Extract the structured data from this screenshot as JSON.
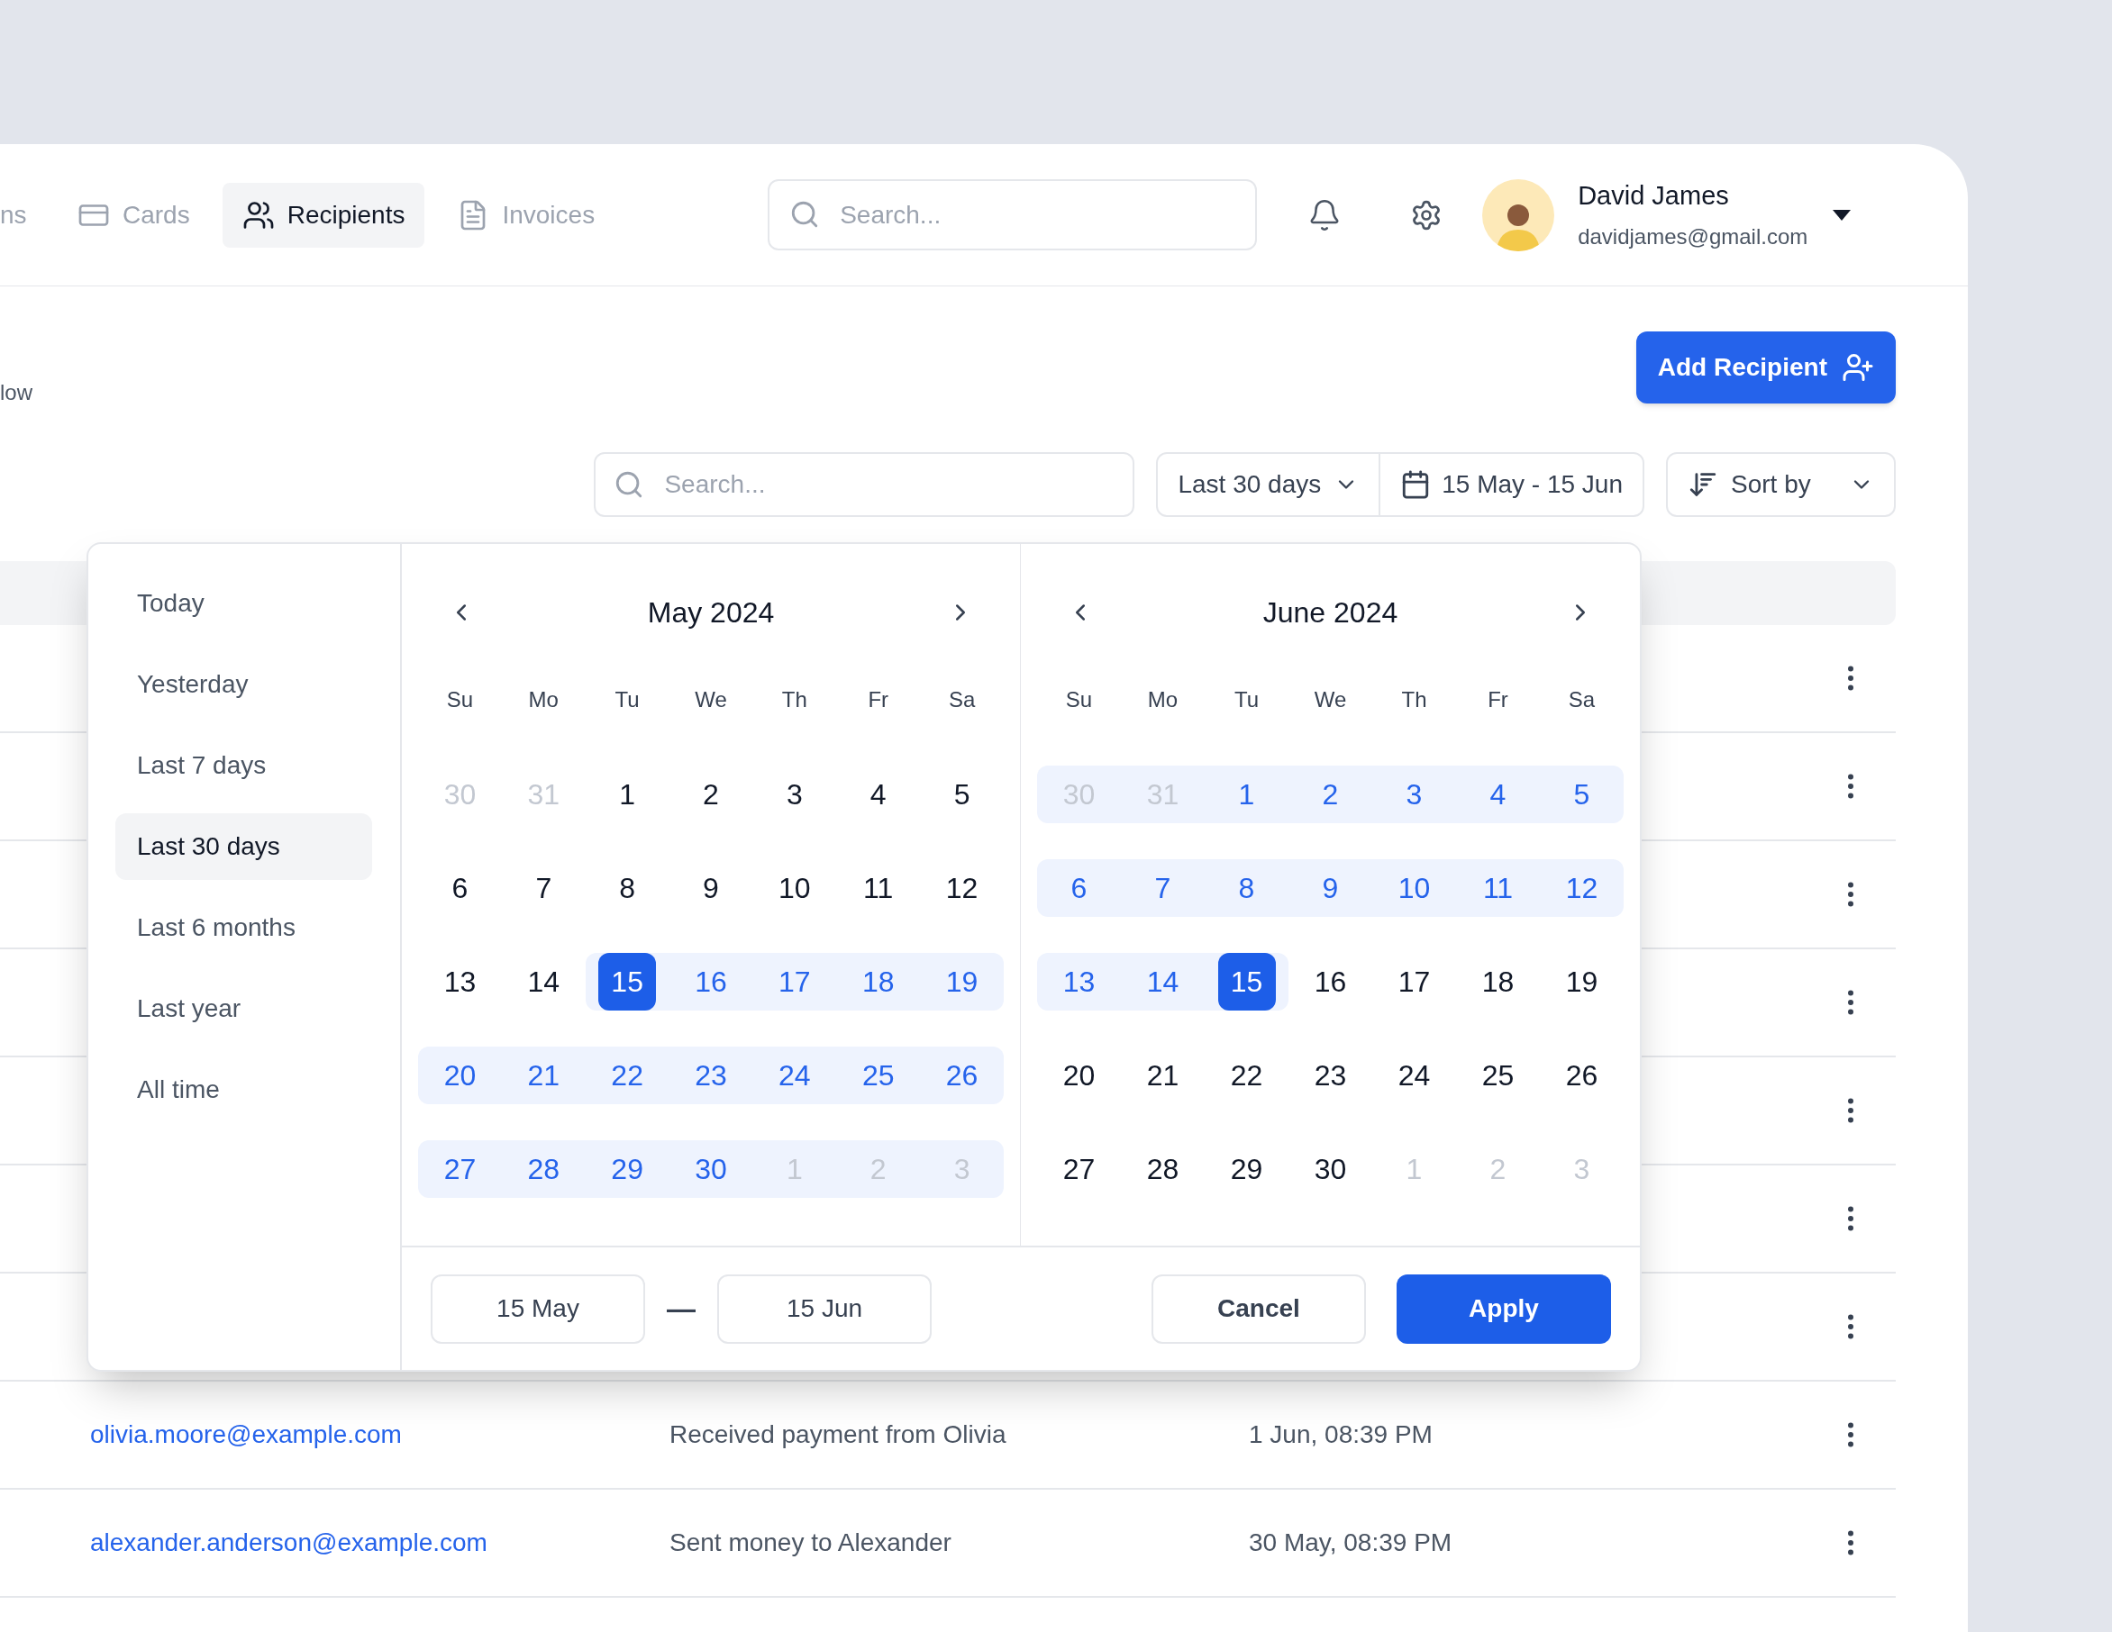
{
  "nav": {
    "cut_label": "ns",
    "tabs": [
      {
        "label": "Cards",
        "selected": false
      },
      {
        "label": "Recipients",
        "selected": true
      },
      {
        "label": "Invoices",
        "selected": false
      }
    ]
  },
  "header_search": {
    "placeholder": "Search..."
  },
  "user": {
    "name": "David James",
    "email": "davidjames@gmail.com"
  },
  "subtitle_cut": "low",
  "add_button": "Add Recipient",
  "toolbar": {
    "search": {
      "placeholder": "Search..."
    },
    "range_select": "Last 30 days",
    "date_range": "15 May - 15 Jun",
    "sort": "Sort by"
  },
  "table": {
    "rows": [
      {
        "email": "olivia.moore@example.com",
        "description": "Received payment from Olivia",
        "date": "1 Jun, 08:39 PM"
      },
      {
        "email": "alexander.anderson@example.com",
        "description": "Sent money to Alexander",
        "date": "30 May, 08:39 PM"
      }
    ]
  },
  "date_picker": {
    "presets": [
      {
        "label": "Today",
        "selected": false
      },
      {
        "label": "Yesterday",
        "selected": false
      },
      {
        "label": "Last 7 days",
        "selected": false
      },
      {
        "label": "Last 30 days",
        "selected": true
      },
      {
        "label": "Last 6 months",
        "selected": false
      },
      {
        "label": "Last year",
        "selected": false
      },
      {
        "label": "All time",
        "selected": false
      }
    ],
    "months": [
      {
        "title": "May 2024",
        "weekdays": [
          "Su",
          "Mo",
          "Tu",
          "We",
          "Th",
          "Fr",
          "Sa"
        ],
        "days": [
          {
            "d": "30",
            "outside": true,
            "in_range": false,
            "selected": false
          },
          {
            "d": "31",
            "outside": true,
            "in_range": false,
            "selected": false
          },
          {
            "d": "1",
            "outside": false,
            "in_range": false,
            "selected": false
          },
          {
            "d": "2",
            "outside": false,
            "in_range": false,
            "selected": false
          },
          {
            "d": "3",
            "outside": false,
            "in_range": false,
            "selected": false
          },
          {
            "d": "4",
            "outside": false,
            "in_range": false,
            "selected": false
          },
          {
            "d": "5",
            "outside": false,
            "in_range": false,
            "selected": false
          },
          {
            "d": "6",
            "outside": false,
            "in_range": false,
            "selected": false
          },
          {
            "d": "7",
            "outside": false,
            "in_range": false,
            "selected": false
          },
          {
            "d": "8",
            "outside": false,
            "in_range": false,
            "selected": false
          },
          {
            "d": "9",
            "outside": false,
            "in_range": false,
            "selected": false
          },
          {
            "d": "10",
            "outside": false,
            "in_range": false,
            "selected": false
          },
          {
            "d": "11",
            "outside": false,
            "in_range": false,
            "selected": false
          },
          {
            "d": "12",
            "outside": false,
            "in_range": false,
            "selected": false
          },
          {
            "d": "13",
            "outside": false,
            "in_range": false,
            "selected": false
          },
          {
            "d": "14",
            "outside": false,
            "in_range": false,
            "selected": false
          },
          {
            "d": "15",
            "outside": false,
            "in_range": true,
            "selected": true
          },
          {
            "d": "16",
            "outside": false,
            "in_range": true,
            "selected": false
          },
          {
            "d": "17",
            "outside": false,
            "in_range": true,
            "selected": false
          },
          {
            "d": "18",
            "outside": false,
            "in_range": true,
            "selected": false
          },
          {
            "d": "19",
            "outside": false,
            "in_range": true,
            "selected": false
          },
          {
            "d": "20",
            "outside": false,
            "in_range": true,
            "selected": false
          },
          {
            "d": "21",
            "outside": false,
            "in_range": true,
            "selected": false
          },
          {
            "d": "22",
            "outside": false,
            "in_range": true,
            "selected": false
          },
          {
            "d": "23",
            "outside": false,
            "in_range": true,
            "selected": false
          },
          {
            "d": "24",
            "outside": false,
            "in_range": true,
            "selected": false
          },
          {
            "d": "25",
            "outside": false,
            "in_range": true,
            "selected": false
          },
          {
            "d": "26",
            "outside": false,
            "in_range": true,
            "selected": false
          },
          {
            "d": "27",
            "outside": false,
            "in_range": true,
            "selected": false
          },
          {
            "d": "28",
            "outside": false,
            "in_range": true,
            "selected": false
          },
          {
            "d": "29",
            "outside": false,
            "in_range": true,
            "selected": false
          },
          {
            "d": "30",
            "outside": false,
            "in_range": true,
            "selected": false
          },
          {
            "d": "1",
            "outside": true,
            "in_range": true,
            "selected": false
          },
          {
            "d": "2",
            "outside": true,
            "in_range": true,
            "selected": false
          },
          {
            "d": "3",
            "outside": true,
            "in_range": true,
            "selected": false
          }
        ]
      },
      {
        "title": "June 2024",
        "weekdays": [
          "Su",
          "Mo",
          "Tu",
          "We",
          "Th",
          "Fr",
          "Sa"
        ],
        "days": [
          {
            "d": "30",
            "outside": true,
            "in_range": true,
            "selected": false
          },
          {
            "d": "31",
            "outside": true,
            "in_range": true,
            "selected": false
          },
          {
            "d": "1",
            "outside": false,
            "in_range": true,
            "selected": false
          },
          {
            "d": "2",
            "outside": false,
            "in_range": true,
            "selected": false
          },
          {
            "d": "3",
            "outside": false,
            "in_range": true,
            "selected": false
          },
          {
            "d": "4",
            "outside": false,
            "in_range": true,
            "selected": false
          },
          {
            "d": "5",
            "outside": false,
            "in_range": true,
            "selected": false
          },
          {
            "d": "6",
            "outside": false,
            "in_range": true,
            "selected": false
          },
          {
            "d": "7",
            "outside": false,
            "in_range": true,
            "selected": false
          },
          {
            "d": "8",
            "outside": false,
            "in_range": true,
            "selected": false
          },
          {
            "d": "9",
            "outside": false,
            "in_range": true,
            "selected": false
          },
          {
            "d": "10",
            "outside": false,
            "in_range": true,
            "selected": false
          },
          {
            "d": "11",
            "outside": false,
            "in_range": true,
            "selected": false
          },
          {
            "d": "12",
            "outside": false,
            "in_range": true,
            "selected": false
          },
          {
            "d": "13",
            "outside": false,
            "in_range": true,
            "selected": false
          },
          {
            "d": "14",
            "outside": false,
            "in_range": true,
            "selected": false
          },
          {
            "d": "15",
            "outside": false,
            "in_range": true,
            "selected": true
          },
          {
            "d": "16",
            "outside": false,
            "in_range": false,
            "selected": false
          },
          {
            "d": "17",
            "outside": false,
            "in_range": false,
            "selected": false
          },
          {
            "d": "18",
            "outside": false,
            "in_range": false,
            "selected": false
          },
          {
            "d": "19",
            "outside": false,
            "in_range": false,
            "selected": false
          },
          {
            "d": "20",
            "outside": false,
            "in_range": false,
            "selected": false
          },
          {
            "d": "21",
            "outside": false,
            "in_range": false,
            "selected": false
          },
          {
            "d": "22",
            "outside": false,
            "in_range": false,
            "selected": false
          },
          {
            "d": "23",
            "outside": false,
            "in_range": false,
            "selected": false
          },
          {
            "d": "24",
            "outside": false,
            "in_range": false,
            "selected": false
          },
          {
            "d": "25",
            "outside": false,
            "in_range": false,
            "selected": false
          },
          {
            "d": "26",
            "outside": false,
            "in_range": false,
            "selected": false
          },
          {
            "d": "27",
            "outside": false,
            "in_range": false,
            "selected": false
          },
          {
            "d": "28",
            "outside": false,
            "in_range": false,
            "selected": false
          },
          {
            "d": "29",
            "outside": false,
            "in_range": false,
            "selected": false
          },
          {
            "d": "30",
            "outside": false,
            "in_range": false,
            "selected": false
          },
          {
            "d": "1",
            "outside": true,
            "in_range": false,
            "selected": false
          },
          {
            "d": "2",
            "outside": true,
            "in_range": false,
            "selected": false
          },
          {
            "d": "3",
            "outside": true,
            "in_range": false,
            "selected": false
          }
        ]
      }
    ],
    "start_field": "15 May",
    "separator": "—",
    "end_field": "15 Jun",
    "cancel": "Cancel",
    "apply": "Apply"
  }
}
